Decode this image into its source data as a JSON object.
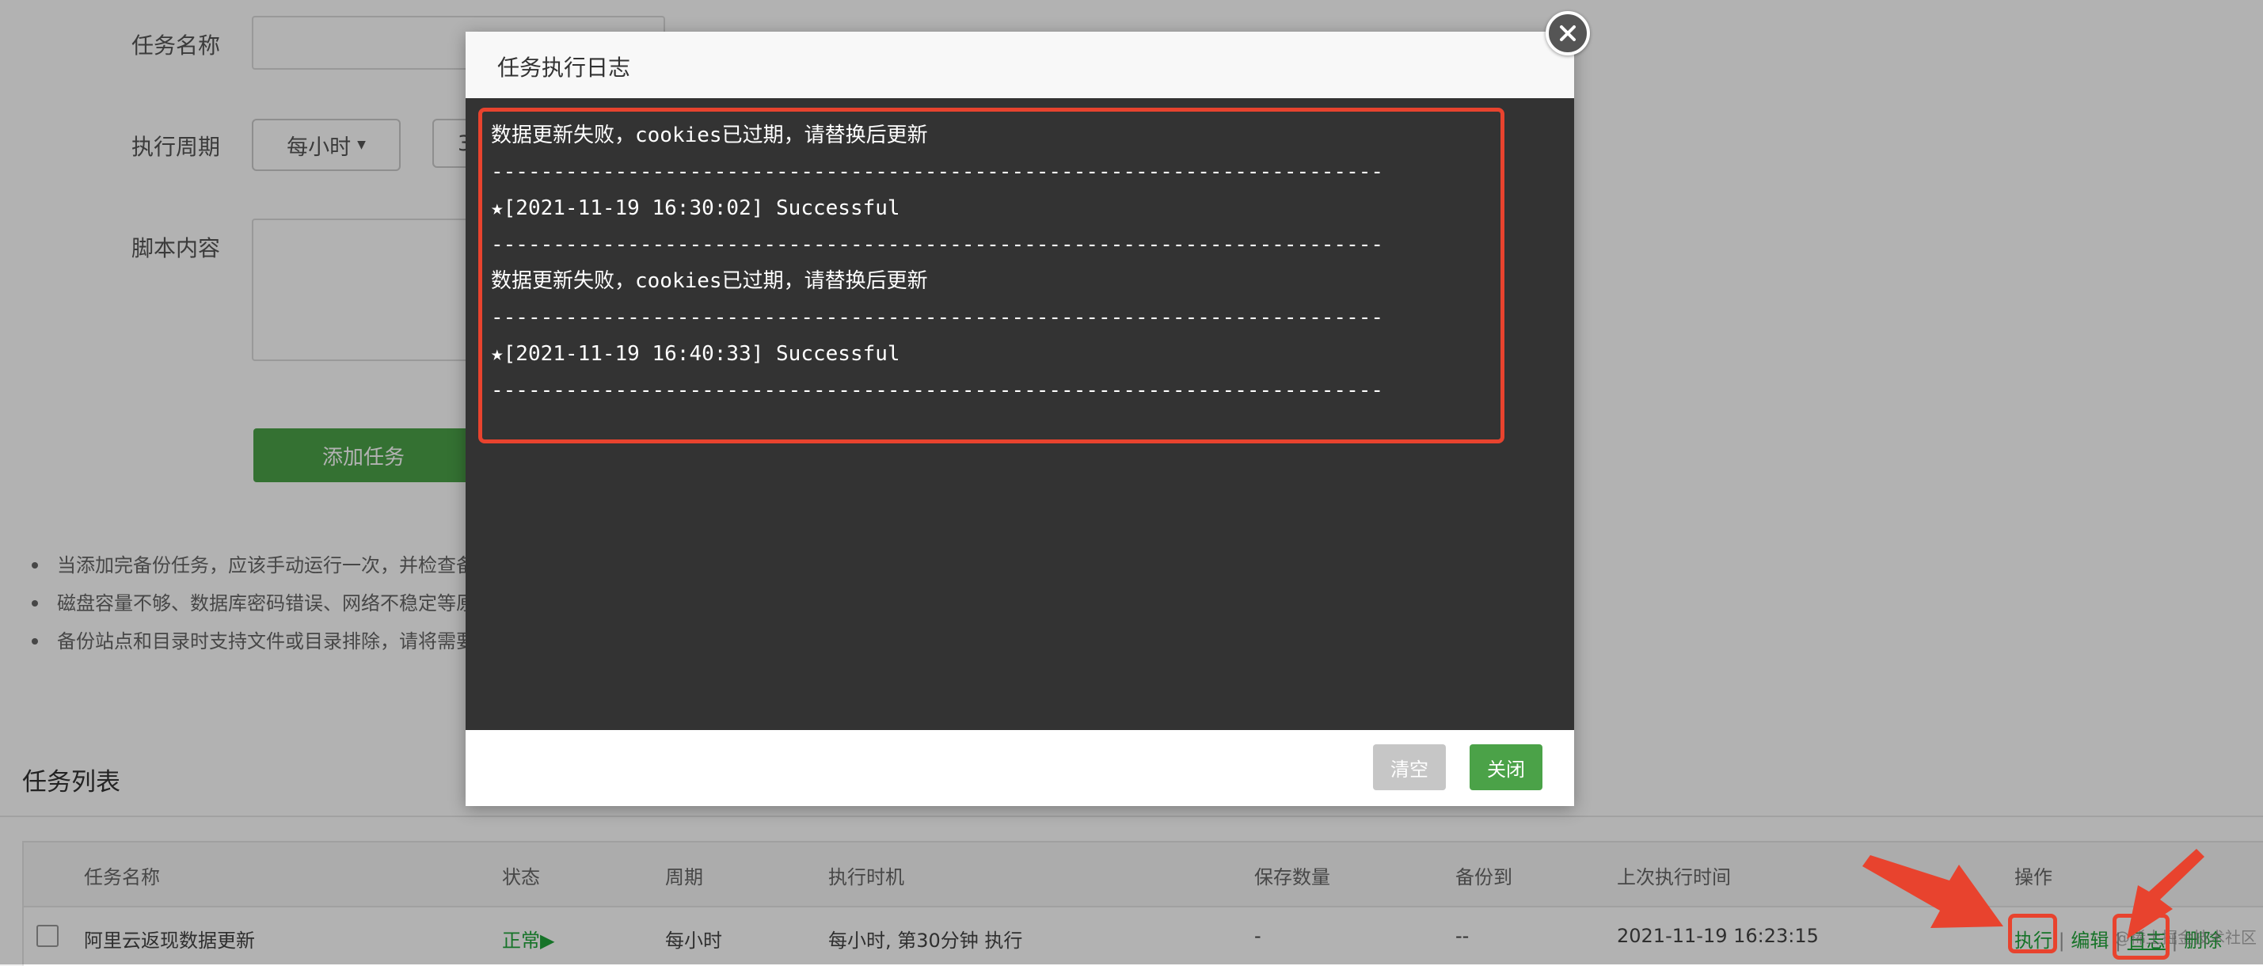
{
  "form": {
    "task_name_label": "任务名称",
    "cycle_label": "执行周期",
    "cycle_value": "每小时",
    "cycle_second_partial": "3",
    "script_label": "脚本内容",
    "add_button": "添加任务",
    "tips": [
      "当添加完备份任务，应该手动运行一次，并检查备",
      "磁盘容量不够、数据库密码错误、网络不稳定等原",
      "备份站点和目录时支持文件或目录排除，请将需要"
    ]
  },
  "task_list": {
    "title": "任务列表",
    "columns": [
      "任务名称",
      "状态",
      "周期",
      "执行时机",
      "保存数量",
      "备份到",
      "上次执行时间",
      "操作"
    ],
    "rows": [
      {
        "name": "阿里云返现数据更新",
        "status": "正常▶",
        "cycle": "每小时",
        "timing": "每小时, 第30分钟 执行",
        "keep": "-",
        "backup_to": "--",
        "last_run": "2021-11-19 16:23:15",
        "ops": {
          "run": "执行",
          "edit": "编辑",
          "log": "日志",
          "delete": "删除"
        }
      }
    ]
  },
  "modal": {
    "title": "任务执行日志",
    "log_lines": [
      "数据更新失败，cookies已过期，请替换后更新",
      "------------------------------------------------------------------------",
      "★[2021-11-19 16:30:02] Successful",
      "------------------------------------------------------------------------",
      "数据更新失败，cookies已过期，请替换后更新",
      "------------------------------------------------------------------------",
      "★[2021-11-19 16:40:33] Successful",
      "------------------------------------------------------------------------"
    ],
    "clear_button": "清空",
    "close_button": "关闭"
  },
  "watermark": "@稀土掘金技术社区",
  "colors": {
    "accent": "#20a53a",
    "button_green": "#4ba248",
    "annotation_red": "#e8432e"
  }
}
